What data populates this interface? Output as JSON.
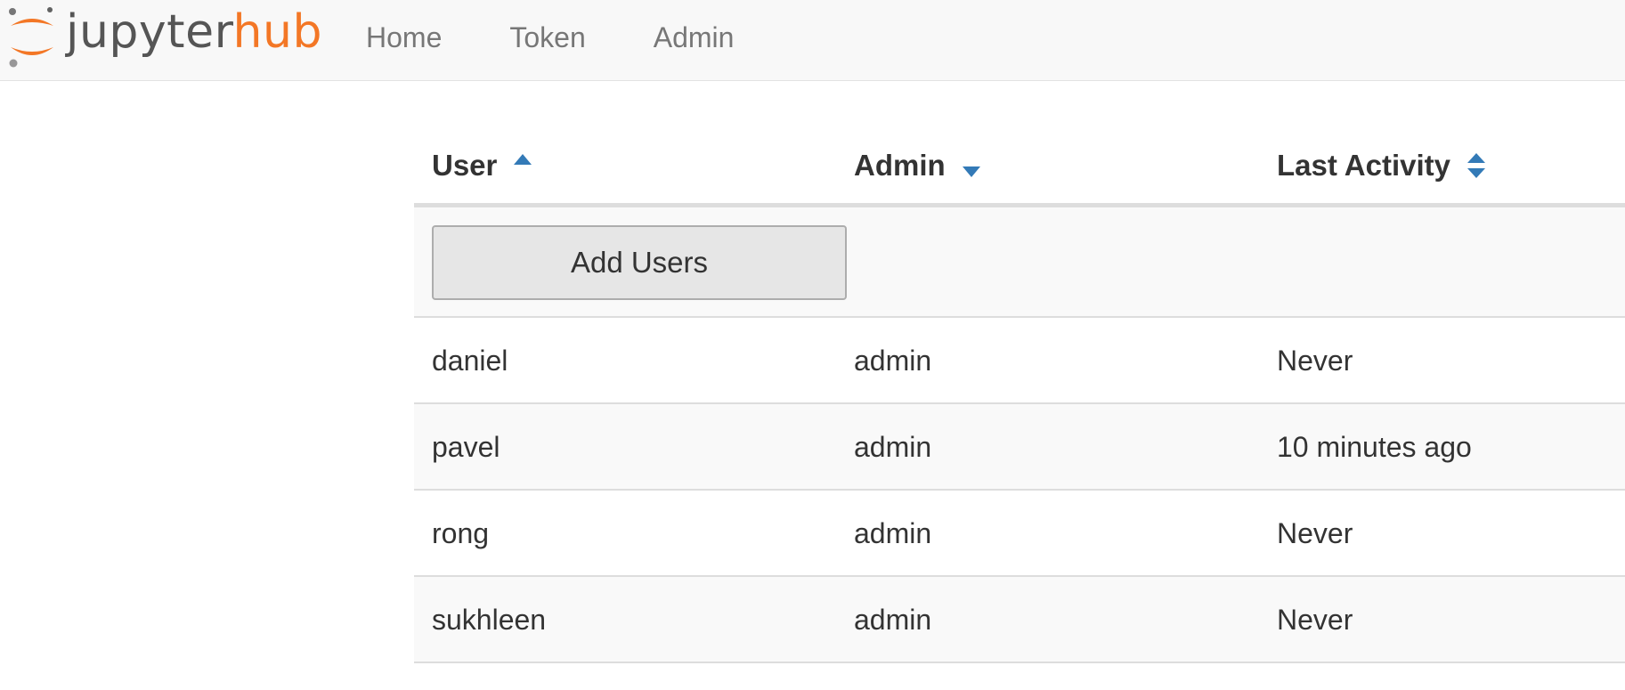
{
  "header": {
    "brand_part1": "jupyter",
    "brand_part2": "hub",
    "brand_colors": {
      "jupyter": "#555555",
      "hub": "#f37726"
    },
    "nav": [
      "Home",
      "Token",
      "Admin"
    ]
  },
  "table": {
    "columns": [
      {
        "label": "User",
        "sort": "ascending",
        "icon": "sort-up-icon"
      },
      {
        "label": "Admin",
        "sort": "descending",
        "icon": "sort-down-icon"
      },
      {
        "label": "Last Activity",
        "sort": "none",
        "icon": "sort-both-icon"
      }
    ],
    "add_users_label": "Add Users",
    "rows": [
      {
        "user": "daniel",
        "admin": "admin",
        "last_activity": "Never"
      },
      {
        "user": "pavel",
        "admin": "admin",
        "last_activity": "10 minutes ago"
      },
      {
        "user": "rong",
        "admin": "admin",
        "last_activity": "Never"
      },
      {
        "user": "sukhleen",
        "admin": "admin",
        "last_activity": "Never"
      }
    ],
    "accent_color": "#337ab7"
  }
}
